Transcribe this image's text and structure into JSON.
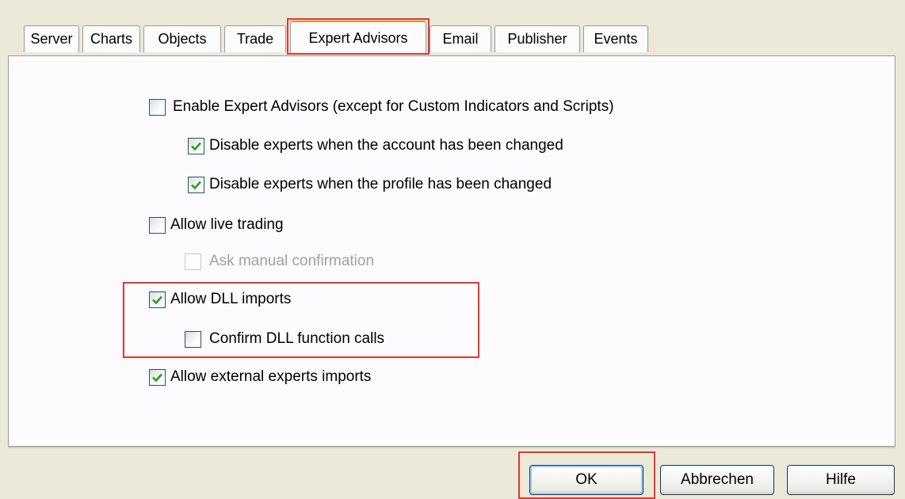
{
  "tabs": [
    {
      "label": "Server"
    },
    {
      "label": "Charts"
    },
    {
      "label": "Objects"
    },
    {
      "label": "Trade"
    },
    {
      "label": "Expert Advisors"
    },
    {
      "label": "Email"
    },
    {
      "label": "Publisher"
    },
    {
      "label": "Events"
    }
  ],
  "active_tab": "Expert Advisors",
  "options": {
    "enable_experts": {
      "label": "Enable Expert Advisors (except for Custom Indicators and Scripts)",
      "checked": false
    },
    "disable_on_account_change": {
      "label": "Disable experts when the account has been changed",
      "checked": true
    },
    "disable_on_profile_change": {
      "label": "Disable experts when the profile has been changed",
      "checked": true
    },
    "allow_live_trading": {
      "label": "Allow live trading",
      "checked": false
    },
    "ask_manual_confirmation": {
      "label": "Ask manual confirmation",
      "checked": false,
      "disabled": true
    },
    "allow_dll_imports": {
      "label": "Allow DLL imports",
      "checked": true
    },
    "confirm_dll_calls": {
      "label": "Confirm DLL function calls",
      "checked": false
    },
    "allow_external_imports": {
      "label": "Allow external experts imports",
      "checked": true
    }
  },
  "buttons": {
    "ok": "OK",
    "cancel": "Abbrechen",
    "help": "Hilfe"
  },
  "colors": {
    "highlight": "#e8342f",
    "check": "#21a121",
    "tab_accent": "#e68b2c"
  },
  "icons": {
    "check": "checkmark-icon"
  }
}
